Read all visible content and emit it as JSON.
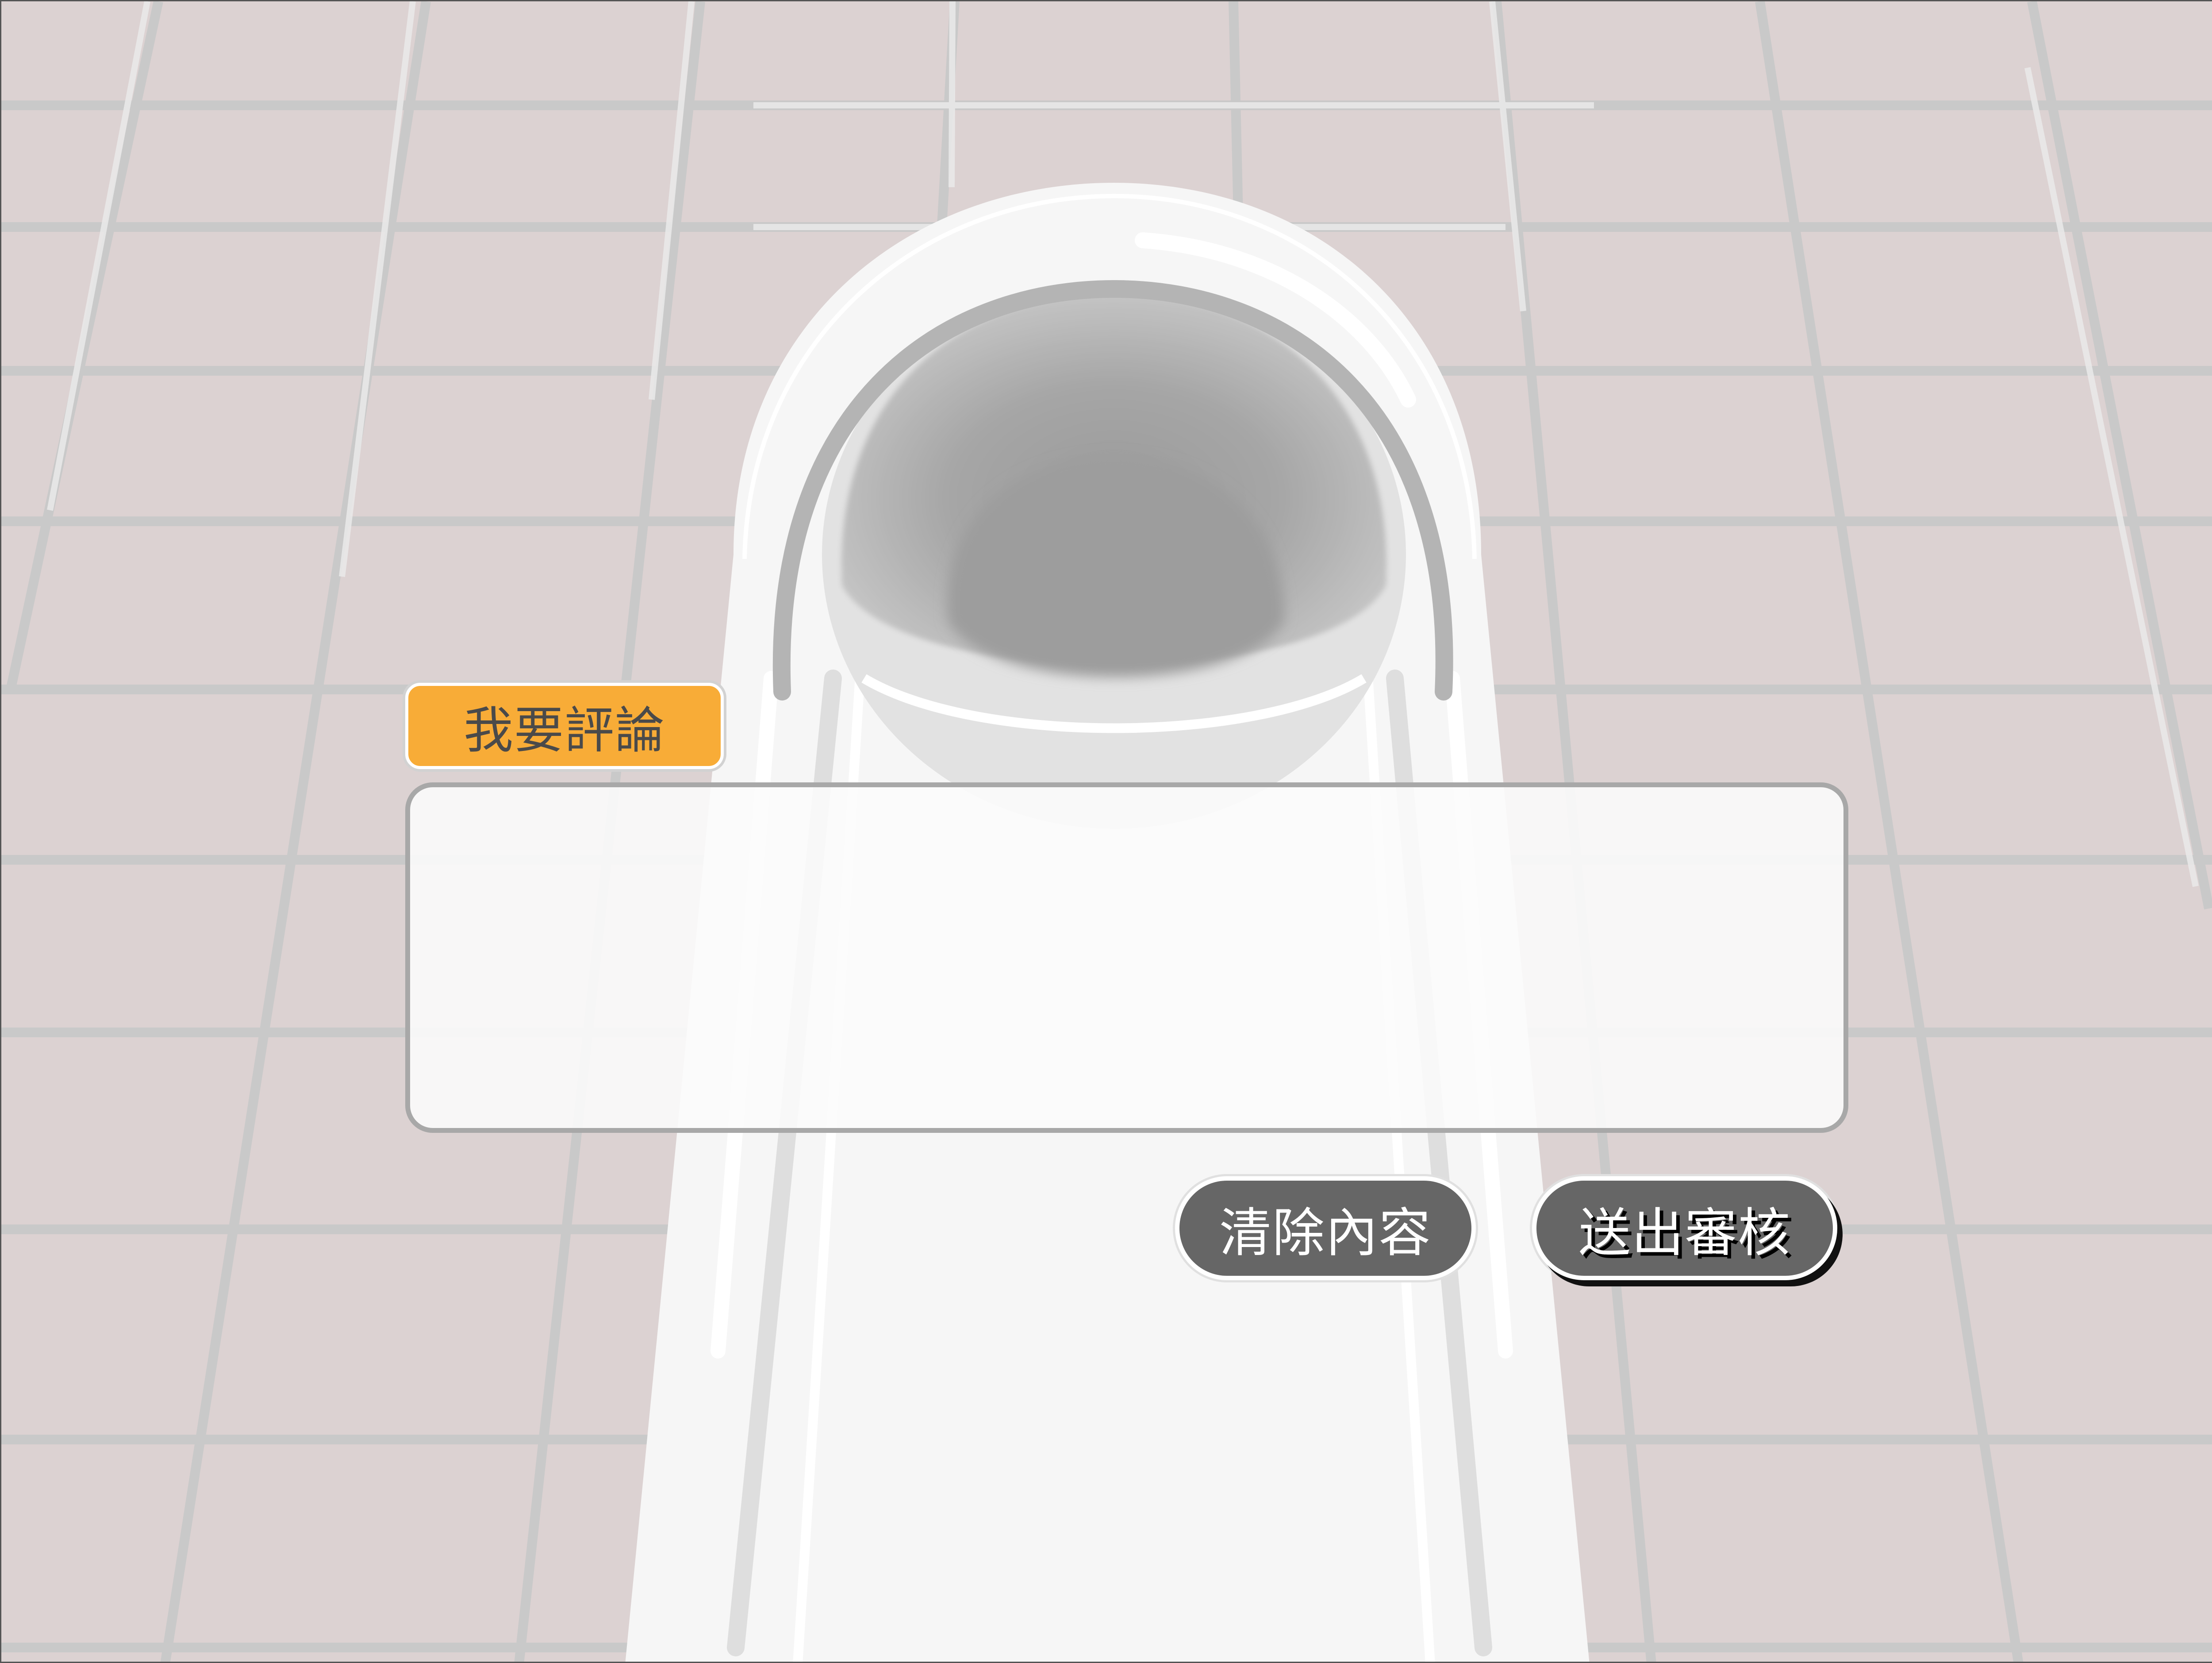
{
  "comment_form": {
    "label": "我要評論",
    "input_value": "",
    "input_placeholder": "",
    "clear_button": "清除內容",
    "submit_button": "送出審核"
  },
  "colors": {
    "label_bg": "#f8ac37",
    "button_bg": "#666666",
    "tile_bg": "#dcd2d2",
    "grout": "#c8c8c8"
  },
  "background": {
    "scene": "bathroom-floor-tiles",
    "object": "squat-toilet-icon"
  }
}
